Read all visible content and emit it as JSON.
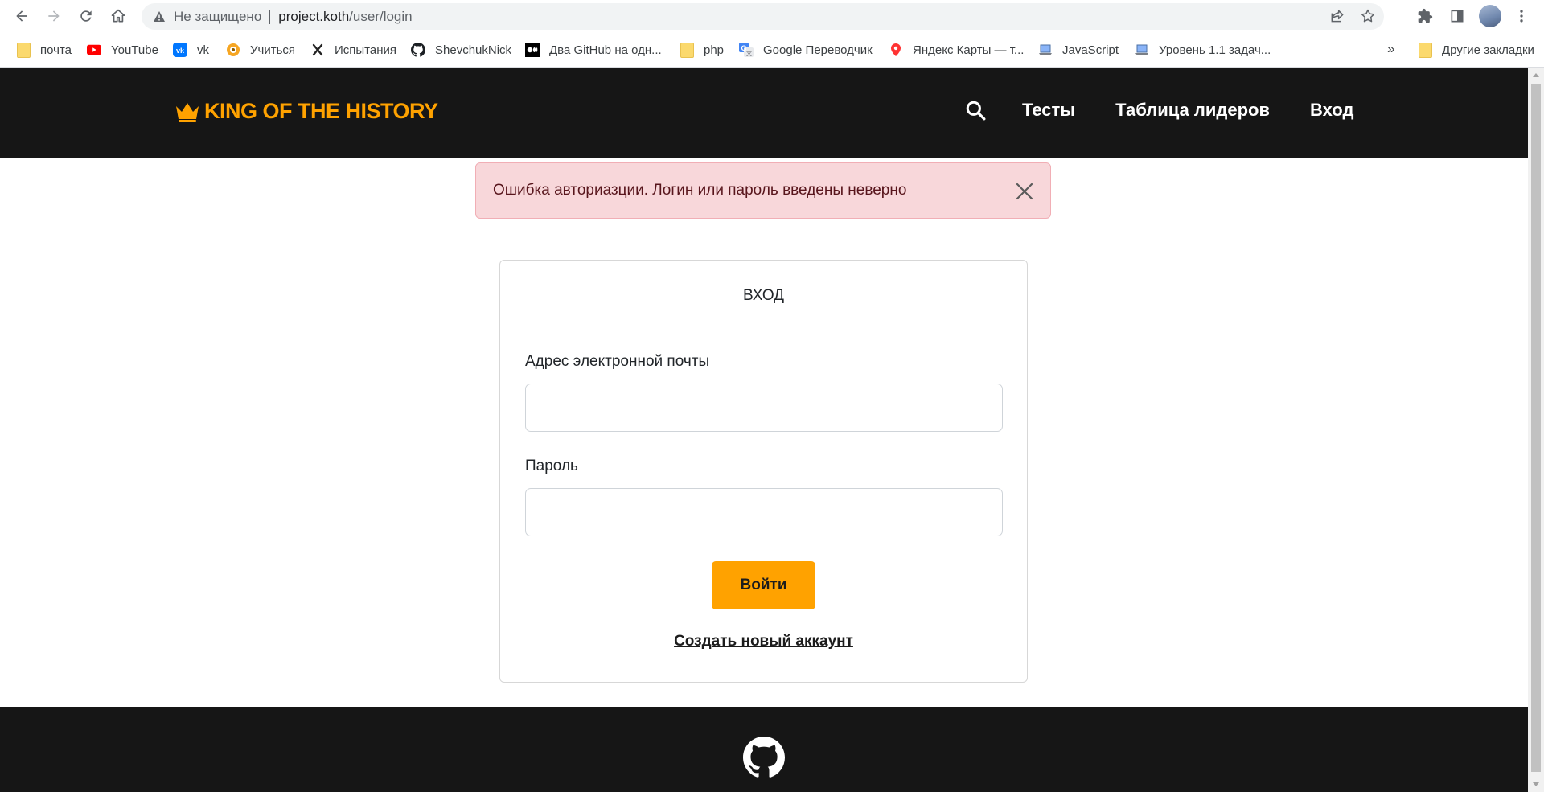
{
  "browser": {
    "security_label": "Не защищено",
    "url_host": "project.koth",
    "url_path": "/user/login",
    "bookmarks": [
      {
        "label": "почта",
        "icon": "folder-icon"
      },
      {
        "label": "YouTube",
        "icon": "youtube-icon"
      },
      {
        "label": "vk",
        "icon": "vk-icon"
      },
      {
        "label": "Учиться",
        "icon": "learn-icon"
      },
      {
        "label": "Испытания",
        "icon": "challenge-icon"
      },
      {
        "label": "ShevchukNick",
        "icon": "github-icon"
      },
      {
        "label": "Два GitHub на одн...",
        "icon": "medium-icon"
      },
      {
        "label": "php",
        "icon": "folder-icon"
      },
      {
        "label": "Google Переводчик",
        "icon": "translate-icon"
      },
      {
        "label": "Яндекс Карты — т...",
        "icon": "map-pin-icon"
      },
      {
        "label": "JavaScript",
        "icon": "laptop-icon"
      },
      {
        "label": "Уровень 1.1 задач...",
        "icon": "laptop-icon"
      }
    ],
    "bookmarks_more": "»",
    "other_bookmarks": "Другие закладки"
  },
  "site": {
    "brand": "KING OF THE HISTORY",
    "nav": {
      "tests": "Тесты",
      "leaderboard": "Таблица лидеров",
      "login": "Вход"
    },
    "alert": "Ошибка авториазции. Логин или пароль введены неверно",
    "form": {
      "title": "ВХОД",
      "email_label": "Адрес электронной почты",
      "email_value": "",
      "password_label": "Пароль",
      "password_value": "",
      "submit": "Войти",
      "signup": "Создать новый аккаунт"
    }
  },
  "colors": {
    "accent": "#ffa200",
    "header_bg": "#161616",
    "alert_bg": "#f8d7da",
    "alert_text": "#58151c"
  }
}
